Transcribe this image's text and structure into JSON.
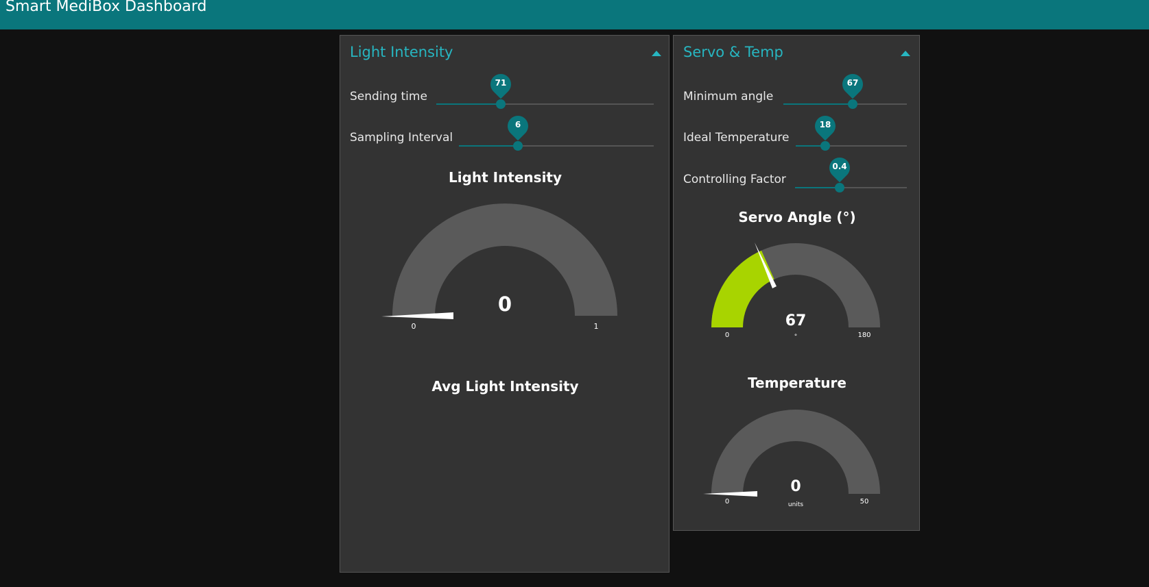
{
  "header": {
    "title": "Smart MediBox Dashboard"
  },
  "colors": {
    "header_bg": "#0a767c",
    "accent": "#27b6c1",
    "gauge_track": "#5a5a5a",
    "servo_fill": "#a8d400",
    "card_bg": "#333333"
  },
  "light_card": {
    "title": "Light Intensity",
    "collapse_icon": "caret-up-icon",
    "sliders": [
      {
        "label": "Sending time",
        "value": 71,
        "display": "71"
      },
      {
        "label": "Sampling Interval",
        "value": 6,
        "display": "6"
      }
    ],
    "gauge": {
      "title": "Light Intensity",
      "value": "0",
      "min": "0",
      "max": "1",
      "level": 0
    },
    "avg_chart": {
      "title": "Avg Light Intensity"
    }
  },
  "servo_card": {
    "title": "Servo & Temp",
    "collapse_icon": "caret-up-icon",
    "sliders": [
      {
        "label": "Minimum angle",
        "value": 67,
        "display": "67"
      },
      {
        "label": "Ideal Temperature",
        "value": 18,
        "display": "18"
      },
      {
        "label": "Controlling Factor",
        "value": 0.4,
        "display": "0.4"
      }
    ],
    "servo_gauge": {
      "title": "Servo Angle (°)",
      "value": "67",
      "units": "°",
      "min": "0",
      "max": "180",
      "level": 0.372
    },
    "temp_gauge": {
      "title": "Temperature",
      "value": "0",
      "units": "units",
      "min": "0",
      "max": "50",
      "level": 0
    }
  }
}
